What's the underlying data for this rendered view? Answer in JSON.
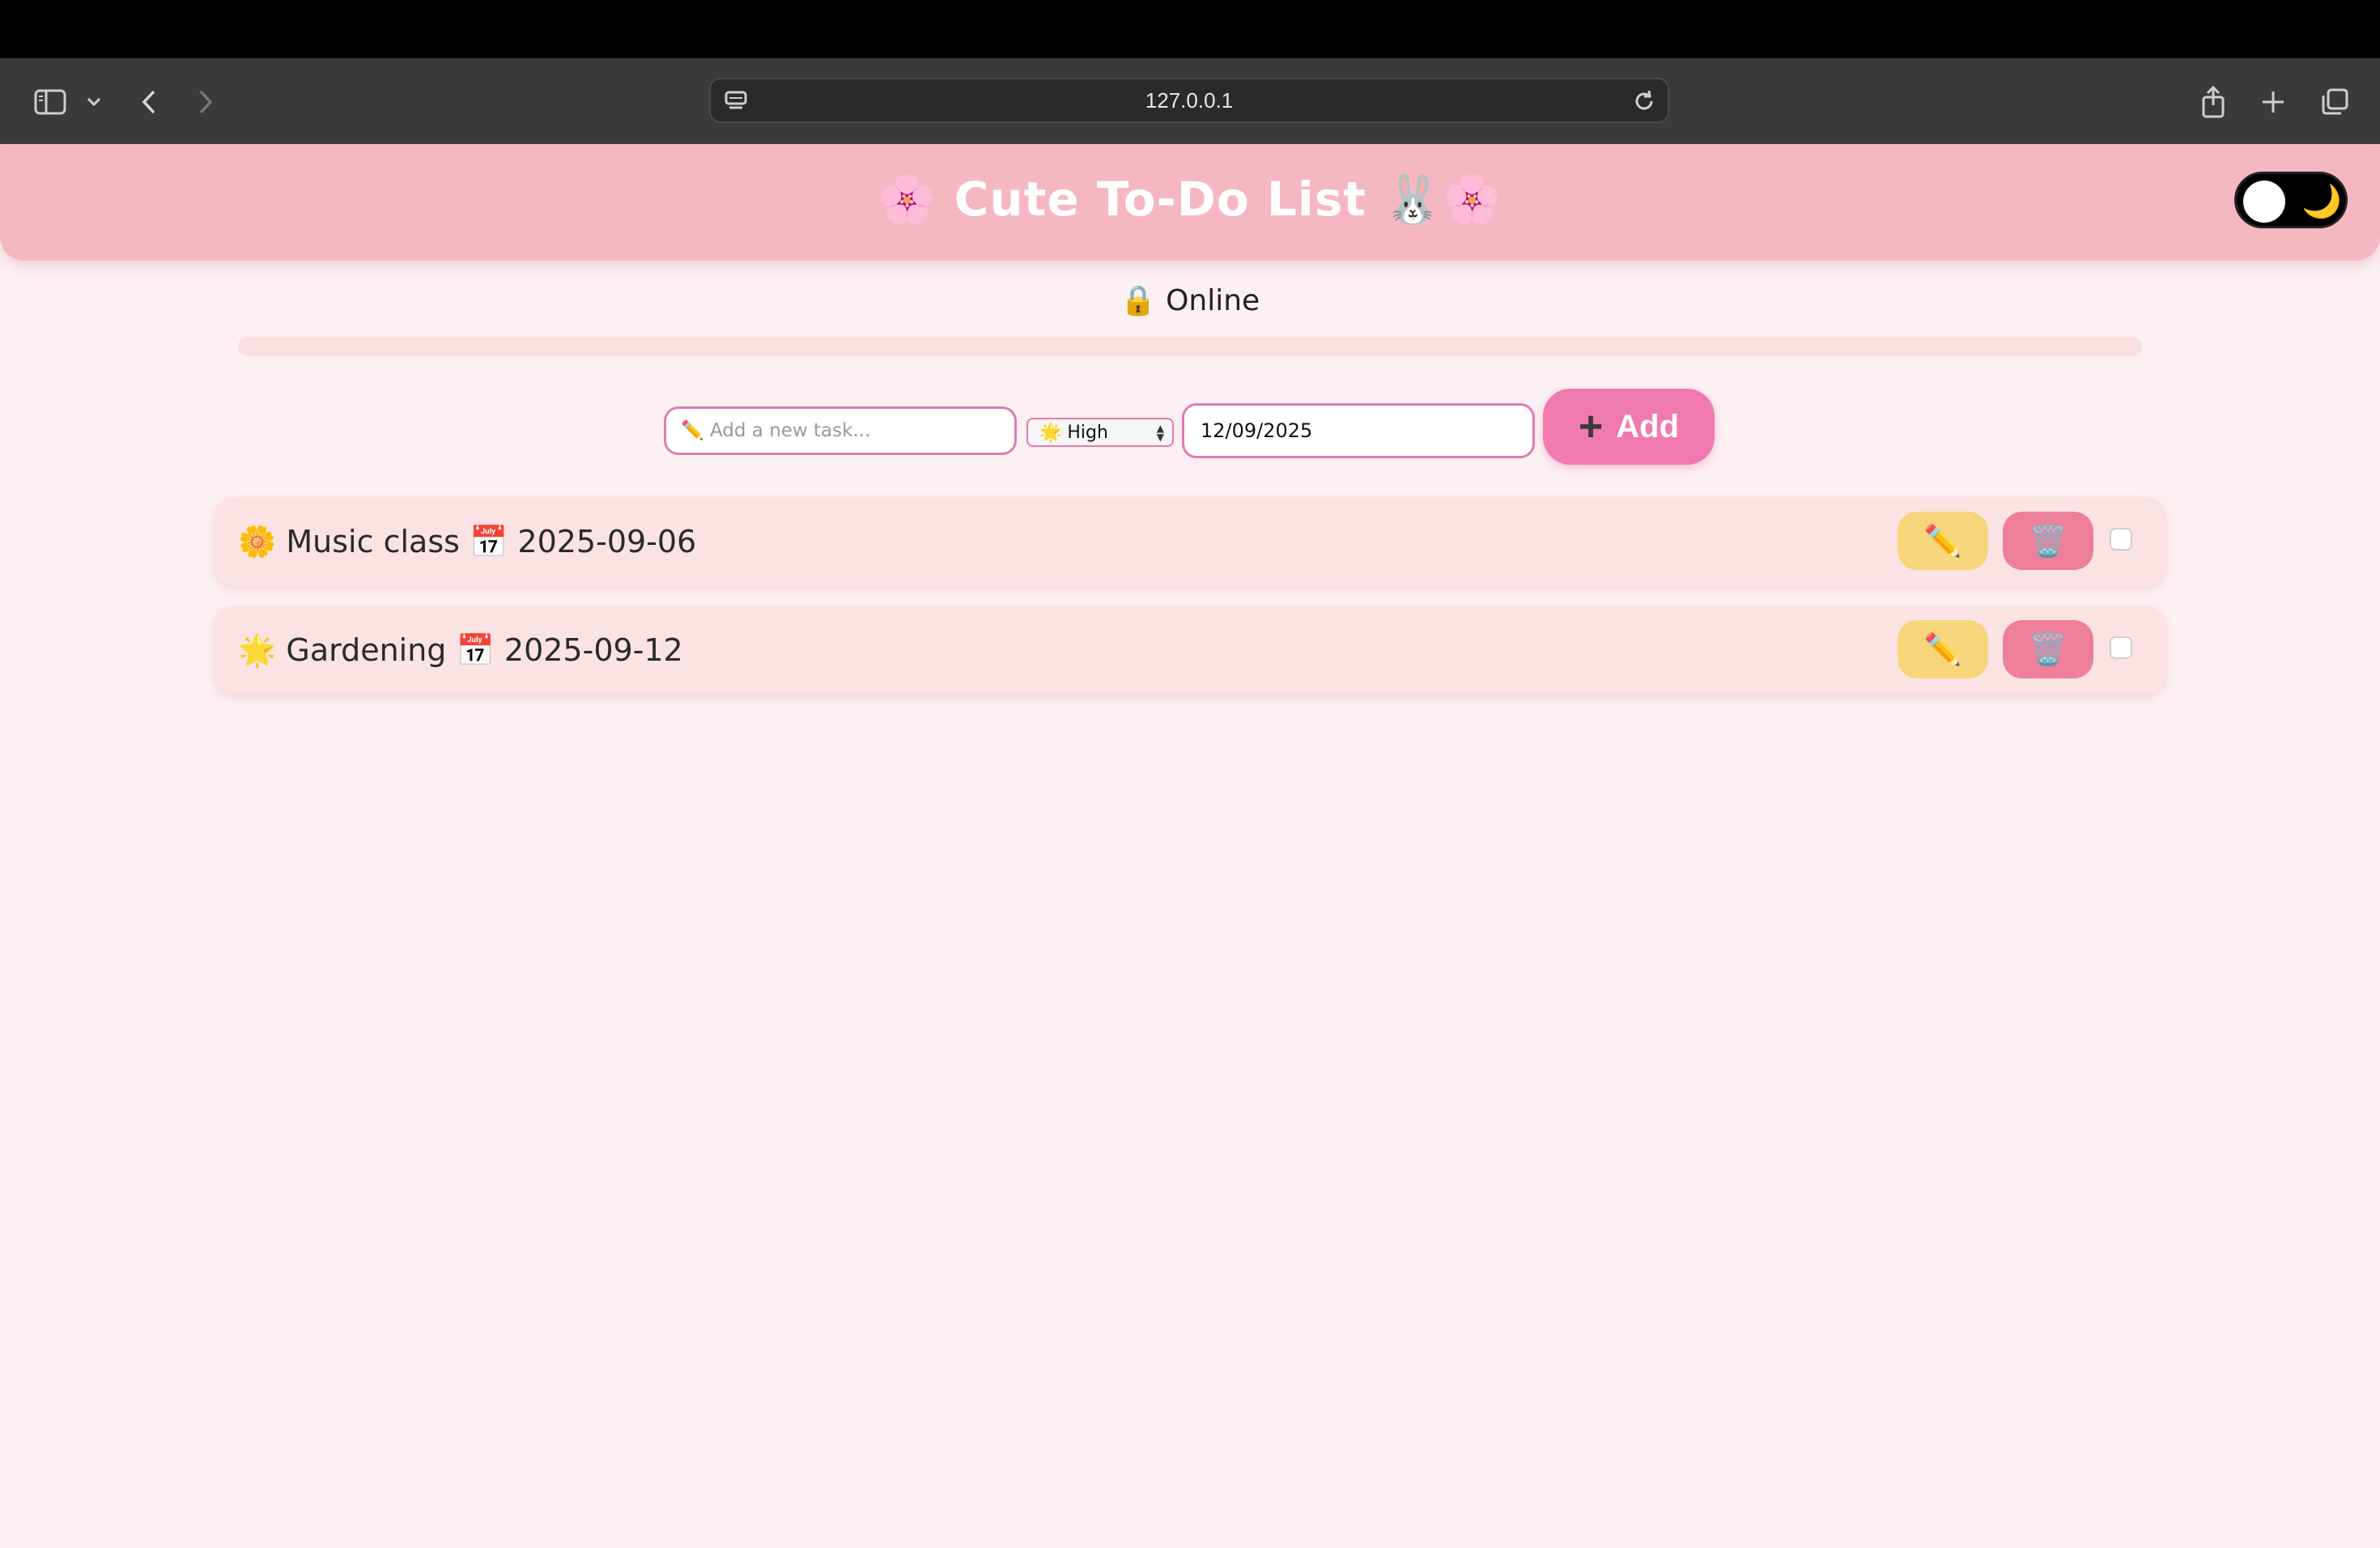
{
  "browser": {
    "url": "127.0.0.1"
  },
  "header": {
    "title": "🌸 Cute To-Do List 🐰🌸",
    "theme_toggle_icon": "🌙"
  },
  "status": {
    "text": "🔒 Online"
  },
  "progress": {
    "fraction": 0
  },
  "form": {
    "task_placeholder": "✏️ Add a new task...",
    "task_value": "",
    "priority_selected": "🌟 High",
    "date_value": "12/09/2025",
    "add_label": "Add",
    "add_icon": "+"
  },
  "tasks": [
    {
      "text": "🌼 Music class 📅 2025-09-06",
      "edit_icon": "✏️",
      "delete_icon": "🗑️",
      "done": false
    },
    {
      "text": "🌟 Gardening 📅 2025-09-12",
      "edit_icon": "✏️",
      "delete_icon": "🗑️",
      "done": false
    }
  ],
  "colors": {
    "header_bg": "#f5b8c2",
    "page_bg": "#fcf0f3",
    "accent": "#f07aad",
    "edit_bg": "#f7d57a",
    "delete_bg": "#ee7f99"
  }
}
